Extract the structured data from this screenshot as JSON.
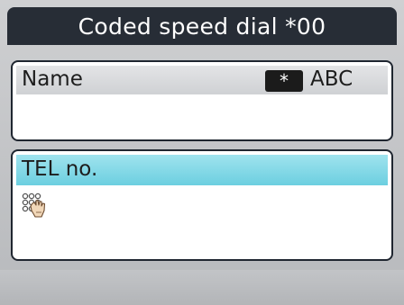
{
  "screen": {
    "title": "Coded speed dial *00"
  },
  "name_field": {
    "label": "Name",
    "key_label": "*",
    "input_mode": "ABC",
    "value": ""
  },
  "tel_field": {
    "label": "TEL no.",
    "value": "",
    "icon": "keypad-touch-icon"
  },
  "colors": {
    "title_bg": "#272d36",
    "selected_row": "#7fd6e5"
  }
}
